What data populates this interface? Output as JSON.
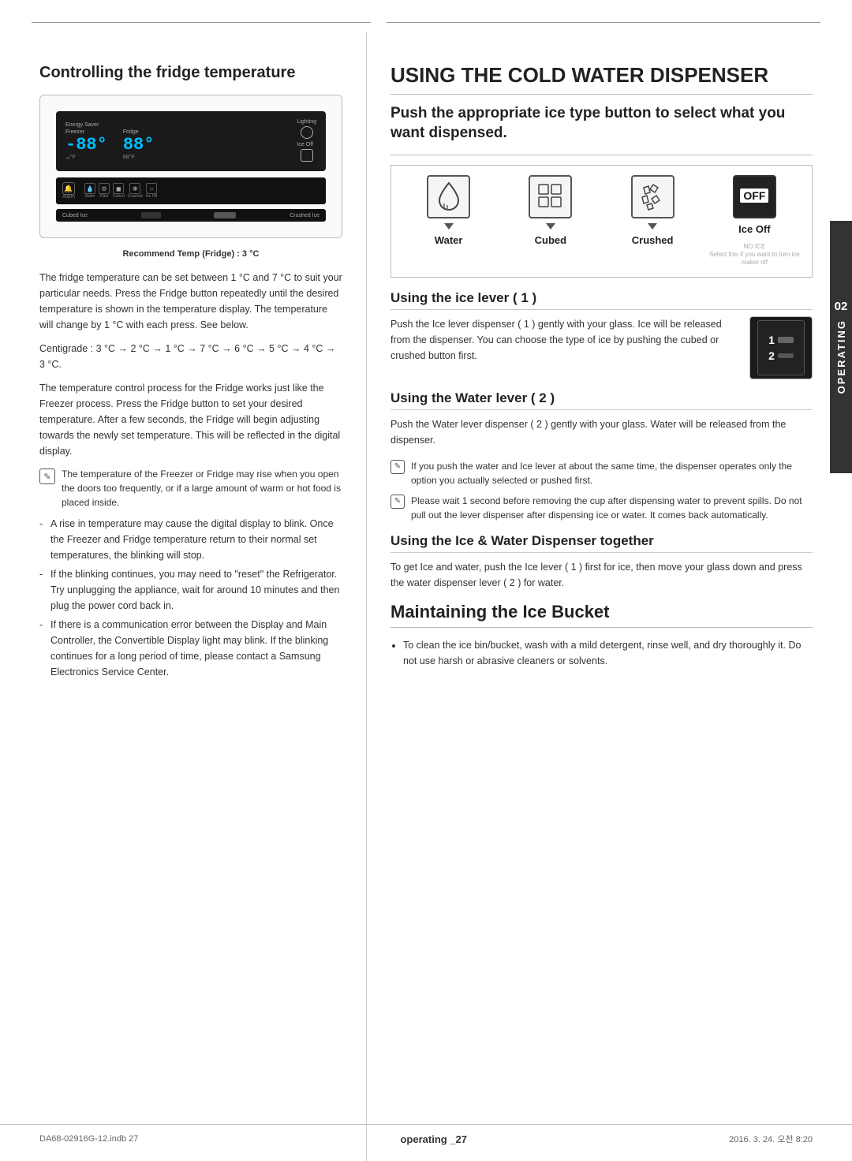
{
  "left": {
    "section_title": "Controlling the fridge temperature",
    "recommend_temp": "Recommend Temp (Fridge) : 3 °C",
    "body_paragraphs": [
      "The fridge temperature can be set between 1 °C and 7 °C to suit your particular needs. Press the Fridge button repeatedly until the desired temperature is shown in the temperature display. The temperature will change by 1 °C with each press. See below.",
      "Centigrade : 3 °C → 2 °C → 1 °C → 7 °C → 6 °C → 5 °C → 4 °C → 3 °C.",
      "The temperature control process for the Fridge works just like the Freezer process. Press the Fridge button to set your desired temperature. After a few seconds, the Fridge will begin adjusting towards the newly set temperature. This will be reflected in the digital display."
    ],
    "notes": [
      "The temperature of the Freezer or Fridge may rise when you open the doors too frequently, or if a large amount of warm or hot food is placed inside."
    ],
    "bullets": [
      "A rise in temperature may cause the digital display to blink. Once the Freezer and Fridge temperature return to their normal set temperatures, the blinking will stop.",
      "If the blinking continues, you may need to \"reset\" the Refrigerator. Try unplugging the appliance, wait for around 10 minutes and then plug the power cord back in.",
      "If there is a communication error between the Display and Main Controller, the Convertible Display light may blink. If the blinking continues for a long period of time, please contact a Samsung Electronics Service Center."
    ]
  },
  "right": {
    "main_title": "USING THE COLD WATER DISPENSER",
    "sub_heading": "Push the appropriate ice type button to select what you want dispensed.",
    "ice_types": [
      {
        "label": "Water",
        "icon": "💧"
      },
      {
        "label": "Cubed",
        "icon": "🧊"
      },
      {
        "label": "Crushed",
        "icon": "❄"
      },
      {
        "label": "Ice Off",
        "sub": "NO ICE",
        "note": "Select this if you want to turn ice maker off"
      }
    ],
    "lever1_title": "Using the ice lever ( 1 )",
    "lever1_body": "Push the Ice lever dispenser ( 1 ) gently with your glass. Ice will be released from the dispenser. You can choose the type of ice by pushing the cubed or crushed button first.",
    "lever2_title": "Using the Water lever ( 2 )",
    "lever2_body": "Push the Water lever dispenser ( 2 ) gently with your glass. Water will be released from the dispenser.",
    "notes2": [
      "If you push the water and Ice lever at about the same time, the dispenser operates only the option you actually selected or pushed first.",
      "Please wait 1 second before removing the cup after dispensing water to prevent spills. Do not pull out the lever dispenser after dispensing ice or water. It comes back automatically."
    ],
    "together_title": "Using the Ice & Water Dispenser together",
    "together_body": "To get Ice and water, push the Ice lever ( 1 ) first for ice, then move your glass down and press the water dispenser lever ( 2 ) for water.",
    "maintaining_title": "Maintaining the Ice Bucket",
    "maintaining_bullets": [
      "To clean the ice bin/bucket, wash with a mild detergent, rinse well, and dry thoroughly it. Do not use harsh or abrasive cleaners or solvents."
    ]
  },
  "footer": {
    "left": "DA68-02916G-12.indb  27",
    "right": "2016. 3. 24.   오전 8:20",
    "page": "operating _27"
  },
  "side_tab": {
    "number": "02",
    "label": "OPERATING"
  }
}
